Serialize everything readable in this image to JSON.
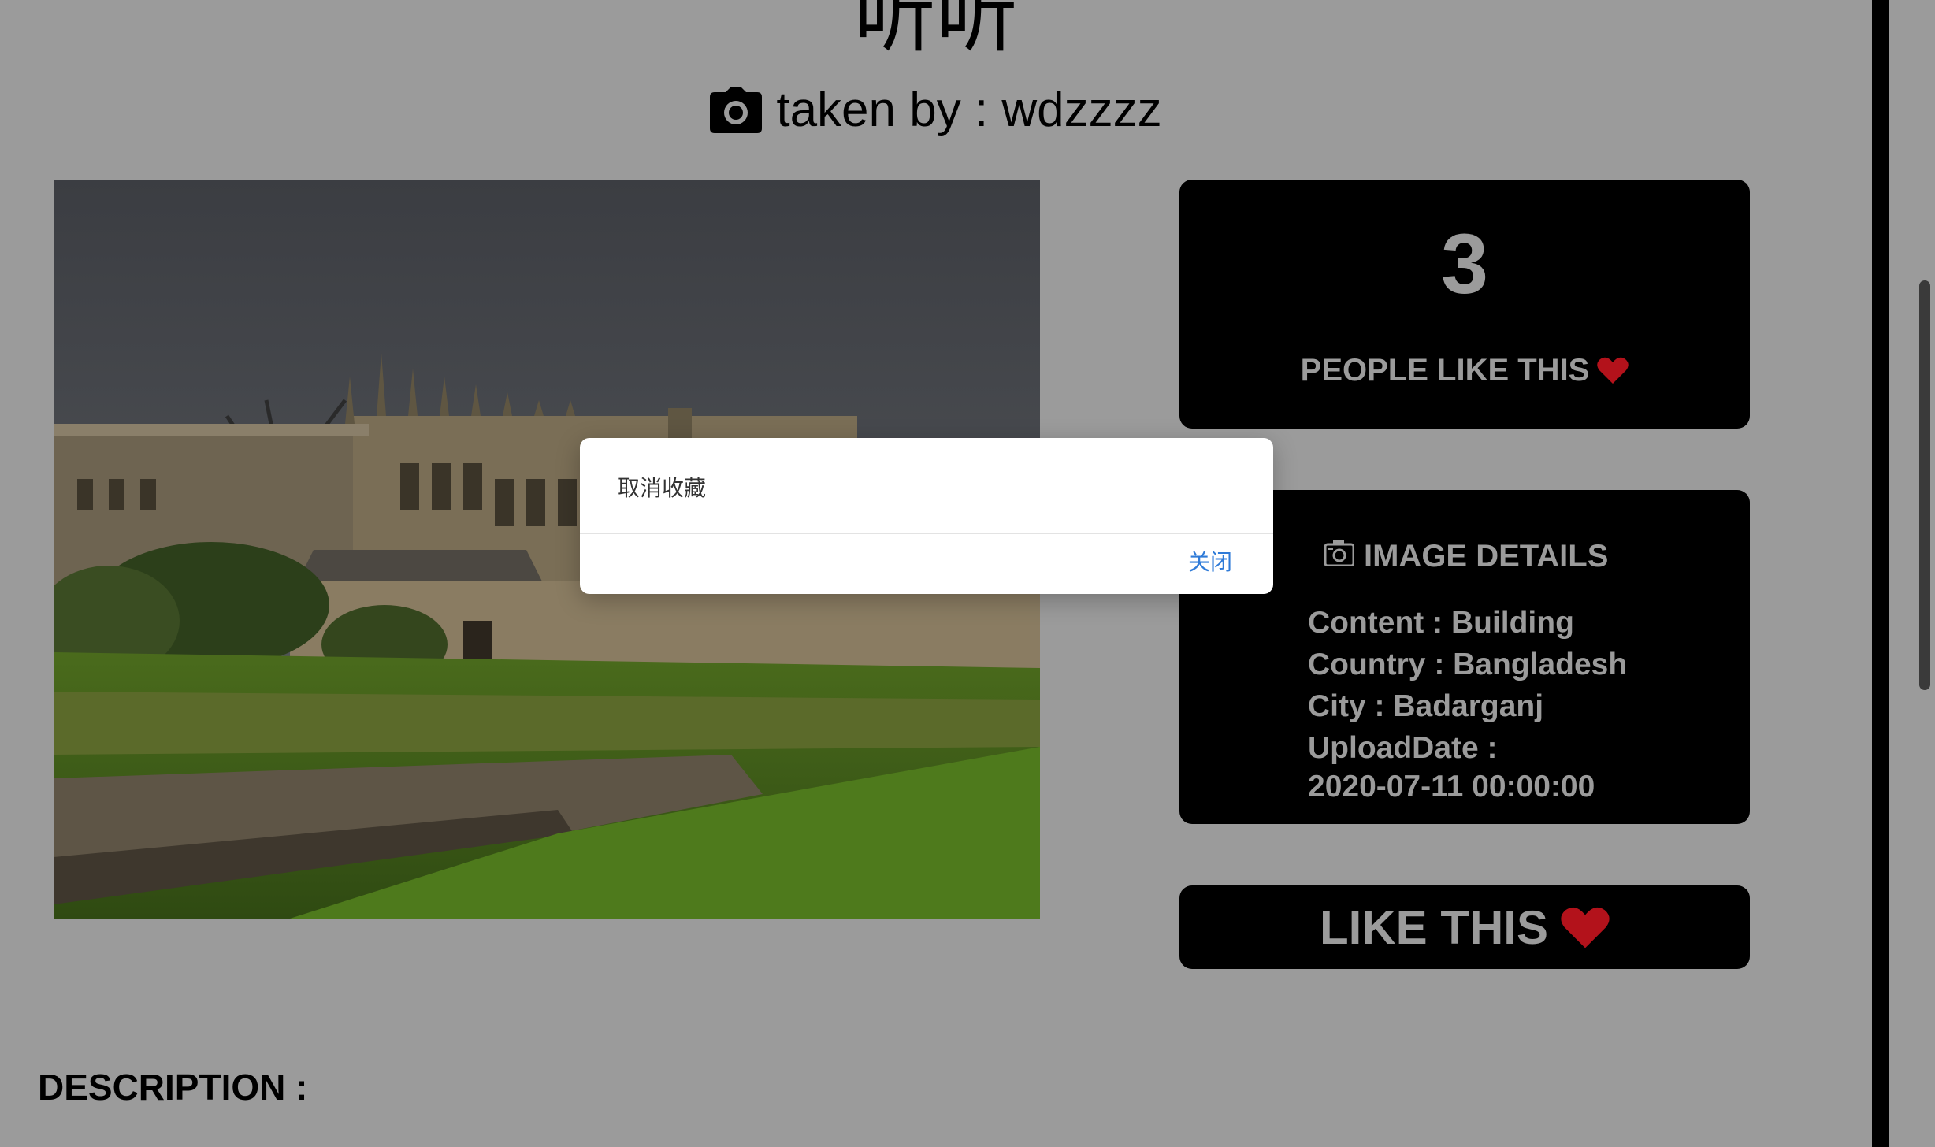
{
  "photo": {
    "title": "听听",
    "taken_by": "taken by : wdzzzz"
  },
  "likes": {
    "count": "3",
    "label": "PEOPLE LIKE THIS"
  },
  "details": {
    "heading": "IMAGE DETAILS",
    "content": "Content : Building",
    "country": "Country : Bangladesh",
    "city": "City : Badarganj",
    "upload_date_label": "UploadDate :",
    "upload_date_value": "2020-07-11 00:00:00"
  },
  "like_button": {
    "label": "LIKE THIS"
  },
  "description": {
    "label": "DESCRIPTION :"
  },
  "dialog": {
    "message": "取消收藏",
    "close_label": "关闭"
  },
  "colors": {
    "page_background": "#9b9b9b",
    "panel_background": "#000000",
    "panel_text": "#9b9b9b",
    "heart": "#b3121b",
    "dialog_link": "#2f7bd8"
  },
  "icons": {
    "camera": "camera-icon",
    "heart": "heart-icon",
    "image_details": "photo-frame-icon"
  }
}
